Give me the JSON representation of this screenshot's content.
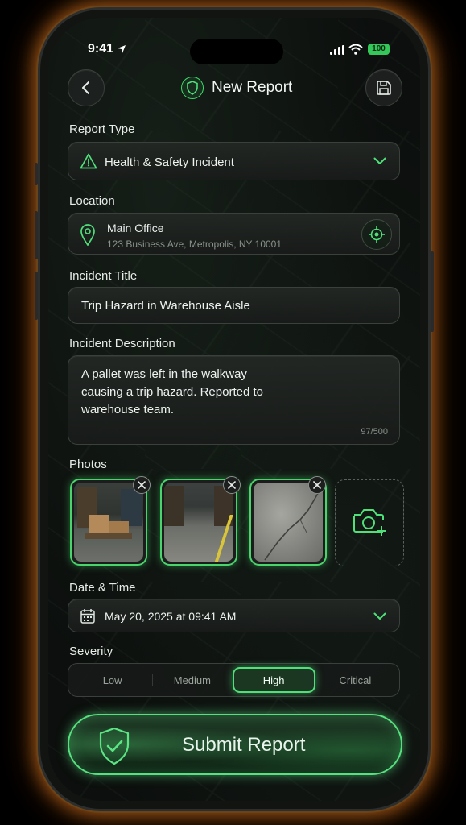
{
  "status_bar": {
    "time": "9:41",
    "battery": "100"
  },
  "header": {
    "title": "New Report"
  },
  "report_type": {
    "label": "Report Type",
    "value": "Health & Safety Incident"
  },
  "location": {
    "label": "Location",
    "name": "Main Office",
    "address": "123 Business Ave, Metropolis, NY 10001"
  },
  "incident_title": {
    "label": "Incident Title",
    "value": "Trip Hazard in Warehouse Aisle"
  },
  "description": {
    "label": "Incident Description",
    "lines": [
      "A pallet was left in the walkway",
      "causing a trip hazard. Reported to",
      "warehouse team."
    ],
    "counter": "97/500"
  },
  "photos": {
    "label": "Photos",
    "count": 3
  },
  "datetime": {
    "label": "Date & Time",
    "value": "May 20, 2025 at 09:41 AM"
  },
  "severity": {
    "label": "Severity",
    "options": [
      "Low",
      "Medium",
      "High",
      "Critical"
    ],
    "selected": "High"
  },
  "submit": {
    "label": "Submit Report"
  },
  "colors": {
    "accent": "#49d46c",
    "glow": "#ff8c28"
  },
  "icons": [
    "back-arrow-icon",
    "shield-icon",
    "save-icon",
    "warning-icon",
    "chevron-down-icon",
    "map-pin-icon",
    "gps-target-icon",
    "close-icon",
    "camera-add-icon",
    "calendar-icon",
    "shield-check-icon"
  ]
}
